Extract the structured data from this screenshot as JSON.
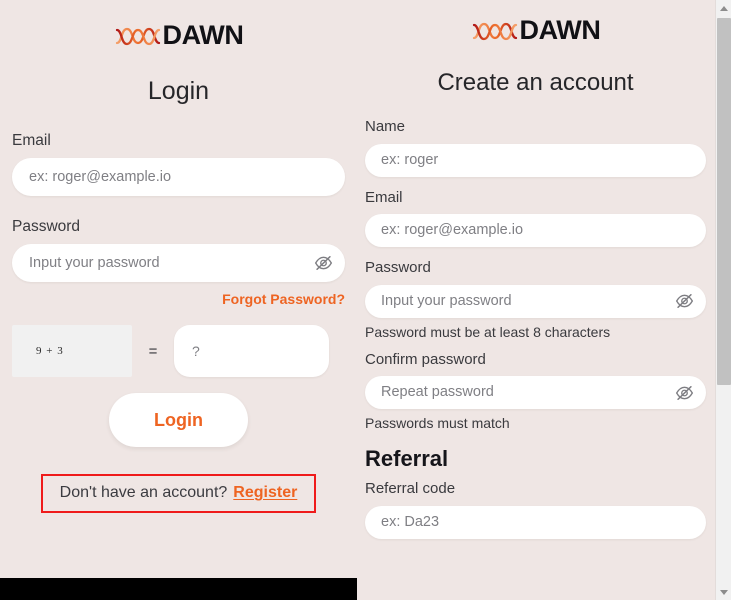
{
  "theme": {
    "background": "#efe6e4",
    "accent": "#ee6422",
    "input_background": "#ffffff",
    "text_primary": "#262629",
    "text_secondary": "#3a3a3e",
    "placeholder": "#7f7f84",
    "highlight_box_border": "#ef1b1b",
    "logo_word_color": "#111115",
    "bottom_bar": "#000000"
  },
  "brand": {
    "wordmark": "DAWN",
    "mark_name": "dawn-wave-logo"
  },
  "login_panel": {
    "title": "Login",
    "email": {
      "label": "Email",
      "placeholder": "ex: roger@example.io",
      "value": ""
    },
    "password": {
      "label": "Password",
      "placeholder": "Input your password",
      "value": "",
      "toggle_icon": "eye-off-icon"
    },
    "forgot_password_label": "Forgot Password?",
    "captcha": {
      "challenge": "9 + 3",
      "equals": "=",
      "answer_placeholder": "?",
      "answer_value": ""
    },
    "submit_label": "Login",
    "register_prompt": {
      "text": "Don't have an account?",
      "link_label": "Register"
    }
  },
  "register_panel": {
    "title": "Create an account",
    "name": {
      "label": "Name",
      "placeholder": "ex: roger",
      "value": ""
    },
    "email": {
      "label": "Email",
      "placeholder": "ex: roger@example.io",
      "value": ""
    },
    "password": {
      "label": "Password",
      "placeholder": "Input your password",
      "value": "",
      "hint": "Password must be at least 8 characters",
      "toggle_icon": "eye-off-icon"
    },
    "confirm_password": {
      "label": "Confirm password",
      "placeholder": "Repeat password",
      "value": "",
      "hint": "Passwords must match",
      "toggle_icon": "eye-off-icon"
    },
    "referral": {
      "heading": "Referral",
      "label": "Referral code",
      "placeholder": "ex: Da23",
      "value": ""
    }
  },
  "scrollbar": {
    "up_arrow_icon": "chevron-up-icon",
    "down_arrow_icon": "chevron-down-icon"
  }
}
